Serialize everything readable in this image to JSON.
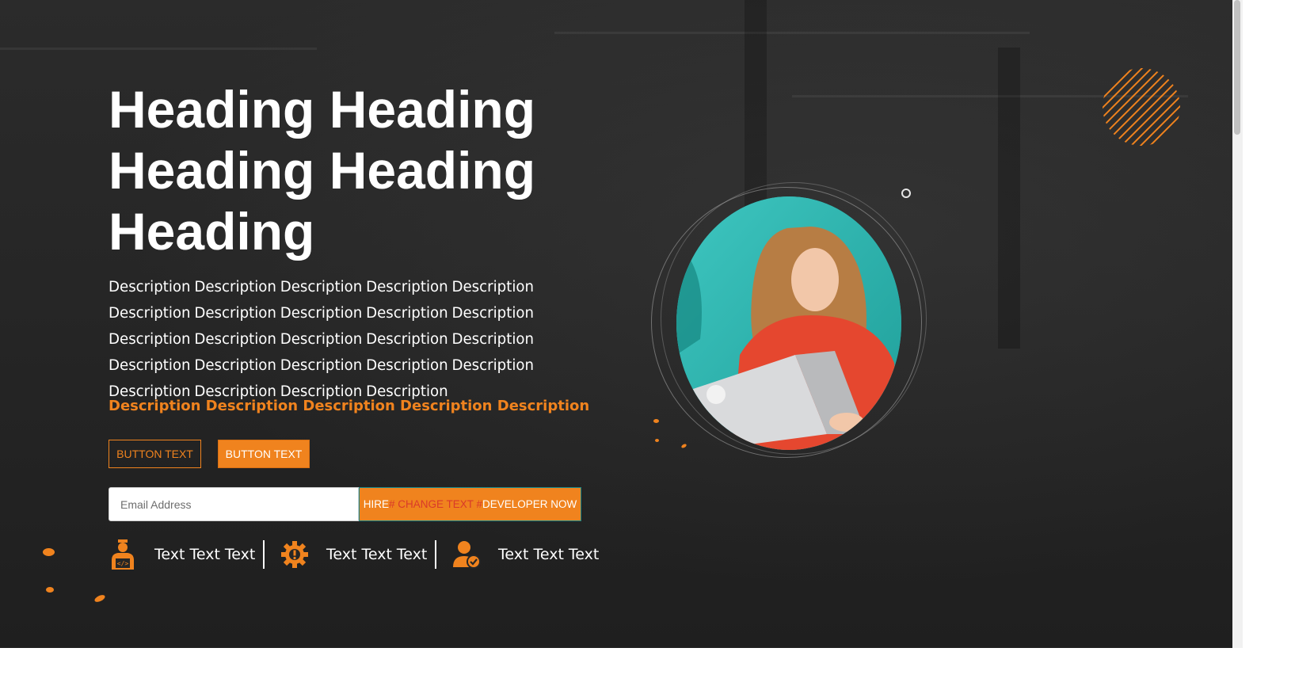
{
  "hero": {
    "heading": "Heading Heading Heading Heading Heading",
    "description": "Description Description Description Description Description Description Description Description Description Description Description Description Description Description Description Description Description Description Description Description Description Description Description Description",
    "tagline": "Description Description Description Description Description",
    "button_outline_label": "BUTTON TEXT",
    "button_filled_label": "BUTTON TEXT"
  },
  "signup": {
    "email_placeholder": "Email Address",
    "hire_prefix": "HIRE",
    "hire_change": "# CHANGE TEXT #",
    "hire_suffix": "DEVELOPER NOW"
  },
  "features": [
    {
      "icon": "developer-icon",
      "label": "Text Text Text"
    },
    {
      "icon": "gear-icon",
      "label": "Text Text Text"
    },
    {
      "icon": "user-check-icon",
      "label": "Text Text Text"
    }
  ],
  "colors": {
    "accent": "#f0831e",
    "background": "#262626",
    "text": "#ffffff",
    "hire_change_text": "#d93a2a"
  }
}
